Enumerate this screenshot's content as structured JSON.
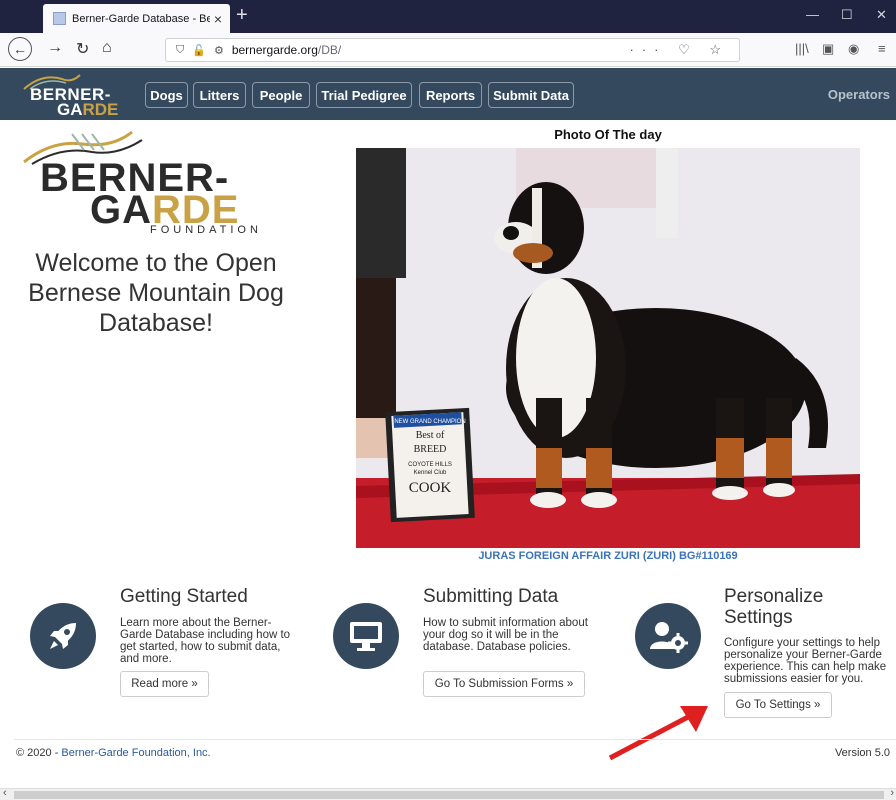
{
  "browser": {
    "tab_title": "Berner-Garde Database - Berne",
    "url_host": "bernergarde.org",
    "url_path": "/DB/"
  },
  "header": {
    "logo_line1": "BERNER-",
    "logo_line2a": "GA",
    "logo_line2b": "RDE",
    "nav": [
      "Dogs",
      "Litters",
      "People",
      "Trial Pedigree",
      "Reports",
      "Submit Data"
    ],
    "operators": "Operators"
  },
  "hero": {
    "logo_line1": "BERNER-",
    "logo_line2a": "GA",
    "logo_line2b": "RDE",
    "logo_line3": "FOUNDATION",
    "welcome": "Welcome to the Open Bernese Mountain Dog Database!"
  },
  "potd": {
    "title": "Photo Of The day",
    "caption": "JURAS FOREIGN AFFAIR ZURI (ZURI)  BG#110169",
    "sign_line1": "NEW GRAND CHAMPION",
    "sign_line2": "Best of",
    "sign_line3": "BREED",
    "sign_line4": "COYOTE HILLS",
    "sign_line5": "Kennel Club",
    "sign_line6": "COOK"
  },
  "features": [
    {
      "title": "Getting Started",
      "desc": "Learn more about the Berner-Garde Database including how to get started, how to submit data, and more.",
      "button": "Read more »",
      "icon": "rocket-icon"
    },
    {
      "title": "Submitting Data",
      "desc": "How to submit information about your dog so it will be in the database. Database policies.",
      "button": "Go To Submission Forms »",
      "icon": "monitor-icon"
    },
    {
      "title": "Personalize Settings",
      "desc": "Configure your settings to help personalize your Berner-Garde experience. This can help make submissions easier for you.",
      "button": "Go To Settings »",
      "icon": "user-gear-icon"
    }
  ],
  "footer": {
    "prefix": "© 2020 - ",
    "link": "Berner-Garde Foundation, Inc.",
    "version": "Version 5.0"
  },
  "colors": {
    "header": "#34495e",
    "accent_gold": "#c9a245",
    "caption_blue": "#3a73b7",
    "annotation_arrow": "#e02020"
  }
}
